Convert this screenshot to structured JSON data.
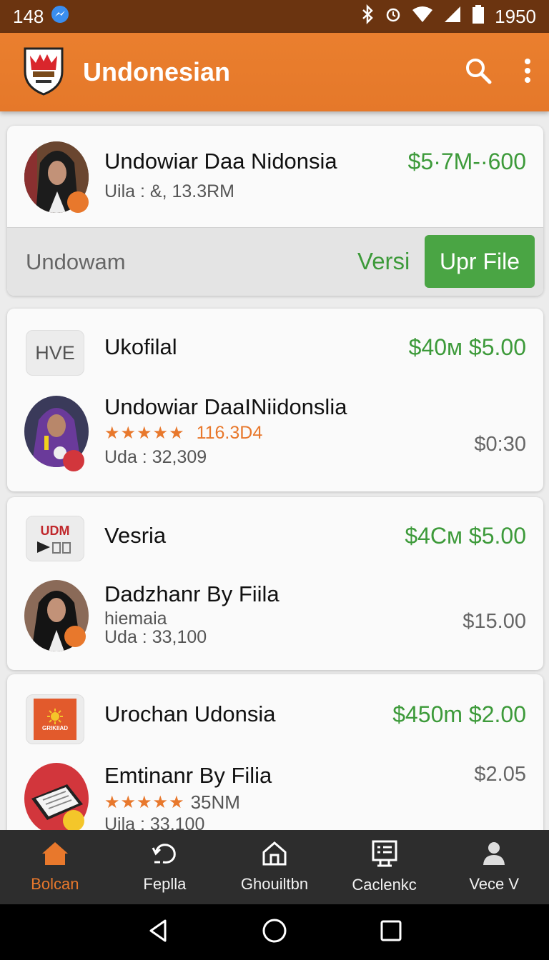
{
  "status": {
    "time_left": "148",
    "time_right": "1950"
  },
  "app": {
    "title": "Undonesian"
  },
  "cards": [
    {
      "title": "Undowiar Daa Nidonsia",
      "sub": "Uila : &, 13.3RM",
      "price": "$5·7M-·600",
      "footer_label": "Undowam",
      "footer_version": "Versi",
      "footer_button": "Upr File"
    },
    {
      "header_thumb": "HVE",
      "header_title": "Ukofilal",
      "header_price": "$40м $5.00",
      "title": "Undowiar DaaINiidonslia",
      "rating": "116.3D4",
      "sub": "Uda : 32,309",
      "price": "$0:30"
    },
    {
      "header_thumb": "UDM",
      "header_title": "Vesria",
      "header_price": "$4Cм $5.00",
      "title": "Dadzhanr By Fiila",
      "sub1": "hiemaia",
      "sub": "Uda : 33,100",
      "price": "$15.00"
    },
    {
      "header_thumb": "GRIKIIAD",
      "header_title": "Urochan Udonsia",
      "header_price": "$450m $2.00",
      "title": "Emtinanr By Filia",
      "rating": "35NM",
      "sub": "Uila : 33,100",
      "price": "$2.05"
    }
  ],
  "nav": [
    {
      "label": "Bolcan",
      "icon": "home-icon",
      "active": true
    },
    {
      "label": "Feplla",
      "icon": "refresh-icon"
    },
    {
      "label": "Ghouiltbn",
      "icon": "house-outline-icon"
    },
    {
      "label": "Caclenkc",
      "icon": "calendar-list-icon"
    },
    {
      "label": "Vece V",
      "icon": "person-icon"
    }
  ],
  "colors": {
    "accent": "#e8782c",
    "status_bar": "#6b3410",
    "green": "#3d9a3a",
    "button_green": "#4aa544"
  }
}
